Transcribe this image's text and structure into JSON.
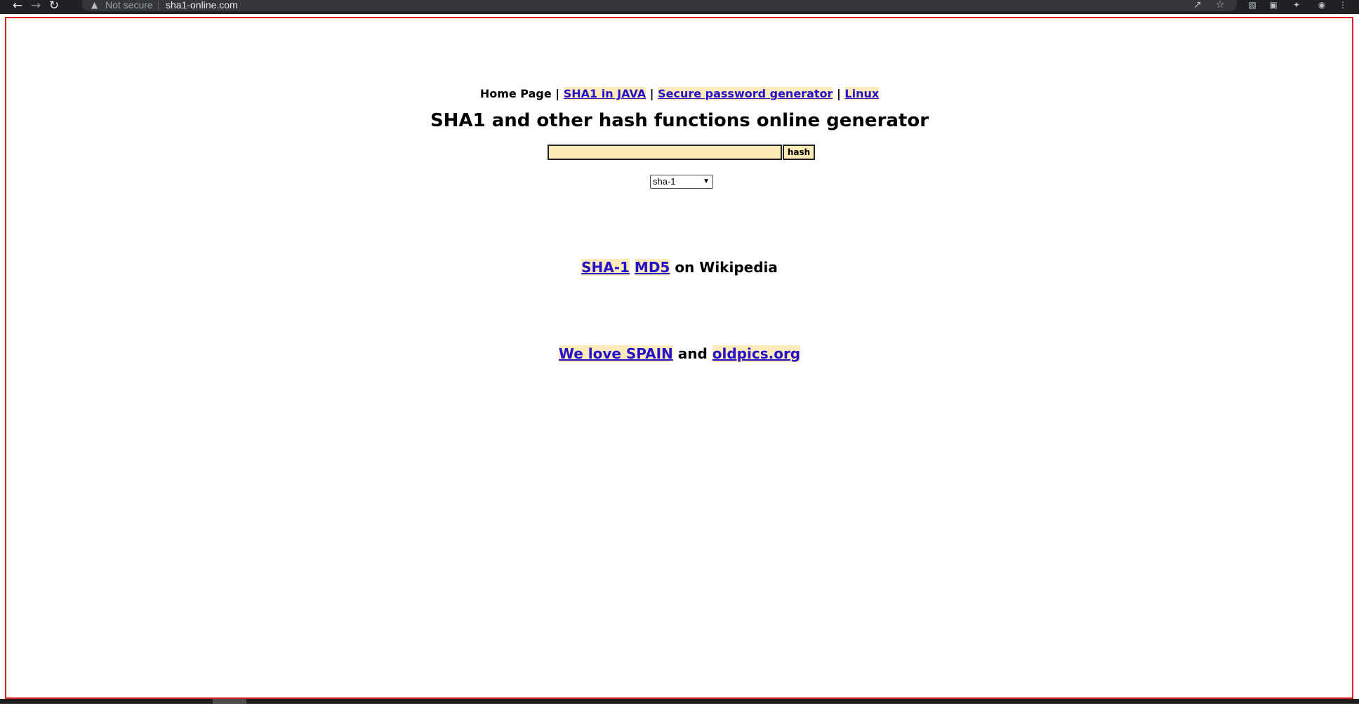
{
  "browser": {
    "security_label": "Not secure",
    "url": "sha1-online.com",
    "icons": {
      "back": "back-arrow-icon",
      "forward": "forward-arrow-icon",
      "reload": "reload-icon",
      "warning": "warning-triangle-icon",
      "share": "share-icon",
      "bookmark": "star-icon",
      "extensions": "puzzle-icon",
      "menu": "kebab-menu-icon"
    }
  },
  "nav": {
    "home_label": "Home Page",
    "separator": "|",
    "links": [
      {
        "label": "SHA1 in JAVA"
      },
      {
        "label": "Secure password generator"
      },
      {
        "label": "Linux"
      }
    ]
  },
  "page": {
    "title": "SHA1 and other hash functions online generator"
  },
  "form": {
    "input_value": "",
    "input_placeholder": "",
    "button_label": "hash",
    "algorithm_selected": "sha-1"
  },
  "wiki": {
    "link1": "SHA-1",
    "link2": "MD5",
    "suffix": "on Wikipedia"
  },
  "promo": {
    "link1": "We love SPAIN",
    "joiner": "and",
    "link2": "oldpics.org"
  },
  "colors": {
    "link": "#2411c9",
    "link_highlight": "#fdeaba",
    "input_bg": "#fdeab5",
    "frame_border": "#e11d1d",
    "chrome_bg": "#202124"
  }
}
